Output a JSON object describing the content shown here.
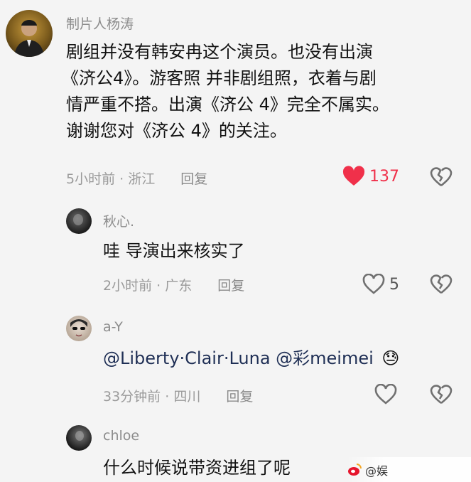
{
  "comments": [
    {
      "username": "制片人杨涛",
      "avatar_icon": "person-in-suit-avatar",
      "lines": [
        "剧组并没有韩安冉这个演员。也没有出演",
        "《济公4》。游客照 并非剧组照，衣着与剧",
        "情严重不搭。出演《济公 4》完全不属实。",
        "谢谢您对《济公 4》的关注。"
      ],
      "time": "5小时前",
      "location": "浙江",
      "reply_label": "回复",
      "likes": "137",
      "liked": true
    },
    {
      "username": "秋心.",
      "avatar_icon": "dark-portrait-avatar",
      "text": "哇 导演出来核实了",
      "time": "2小时前",
      "location": "广东",
      "reply_label": "回复",
      "likes": "5",
      "liked": false
    },
    {
      "username": "a-Y",
      "avatar_icon": "sunglasses-portrait-avatar",
      "mention_text": "@Liberty·Clair·Luna @彩meimei",
      "emoji": "😓",
      "time": "33分钟前",
      "location": "四川",
      "reply_label": "回复",
      "liked": false
    },
    {
      "username": "chloe",
      "avatar_icon": "dark-portrait-avatar",
      "text": "什么时候说带资进组了呢"
    }
  ],
  "colors": {
    "like_active": "#f0304a",
    "icon_gray": "#707070"
  },
  "watermark": {
    "text": "@娱"
  }
}
